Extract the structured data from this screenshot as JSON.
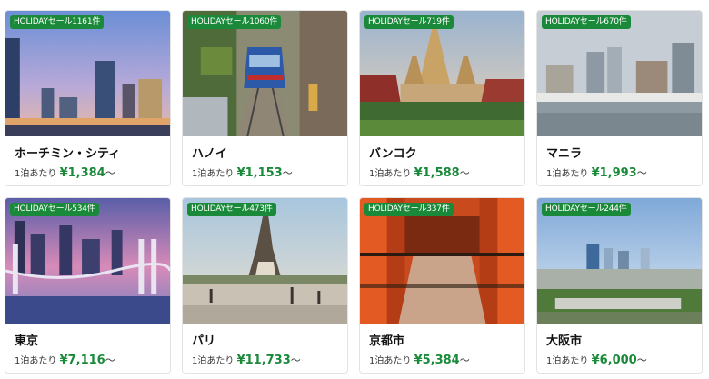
{
  "cards": [
    {
      "badge": "HOLIDAYセール1161件",
      "city": "ホーチミン・シティ",
      "per_night": "1泊あたり",
      "price": "¥1,384",
      "suffix": "〜"
    },
    {
      "badge": "HOLIDAYセール1060件",
      "city": "ハノイ",
      "per_night": "1泊あたり",
      "price": "¥1,153",
      "suffix": "〜"
    },
    {
      "badge": "HOLIDAYセール719件",
      "city": "バンコク",
      "per_night": "1泊あたり",
      "price": "¥1,588",
      "suffix": "〜"
    },
    {
      "badge": "HOLIDAYセール670件",
      "city": "マニラ",
      "per_night": "1泊あたり",
      "price": "¥1,993",
      "suffix": "〜"
    },
    {
      "badge": "HOLIDAYセール534件",
      "city": "東京",
      "per_night": "1泊あたり",
      "price": "¥7,116",
      "suffix": "〜"
    },
    {
      "badge": "HOLIDAYセール473件",
      "city": "パリ",
      "per_night": "1泊あたり",
      "price": "¥11,733",
      "suffix": "〜"
    },
    {
      "badge": "HOLIDAYセール337件",
      "city": "京都市",
      "per_night": "1泊あたり",
      "price": "¥5,384",
      "suffix": "〜"
    },
    {
      "badge": "HOLIDAYセール244件",
      "city": "大阪市",
      "per_night": "1泊あたり",
      "price": "¥6,000",
      "suffix": "〜"
    }
  ],
  "colors": {
    "badge_bg": "#1a8a3a",
    "price": "#1a8a3a"
  }
}
